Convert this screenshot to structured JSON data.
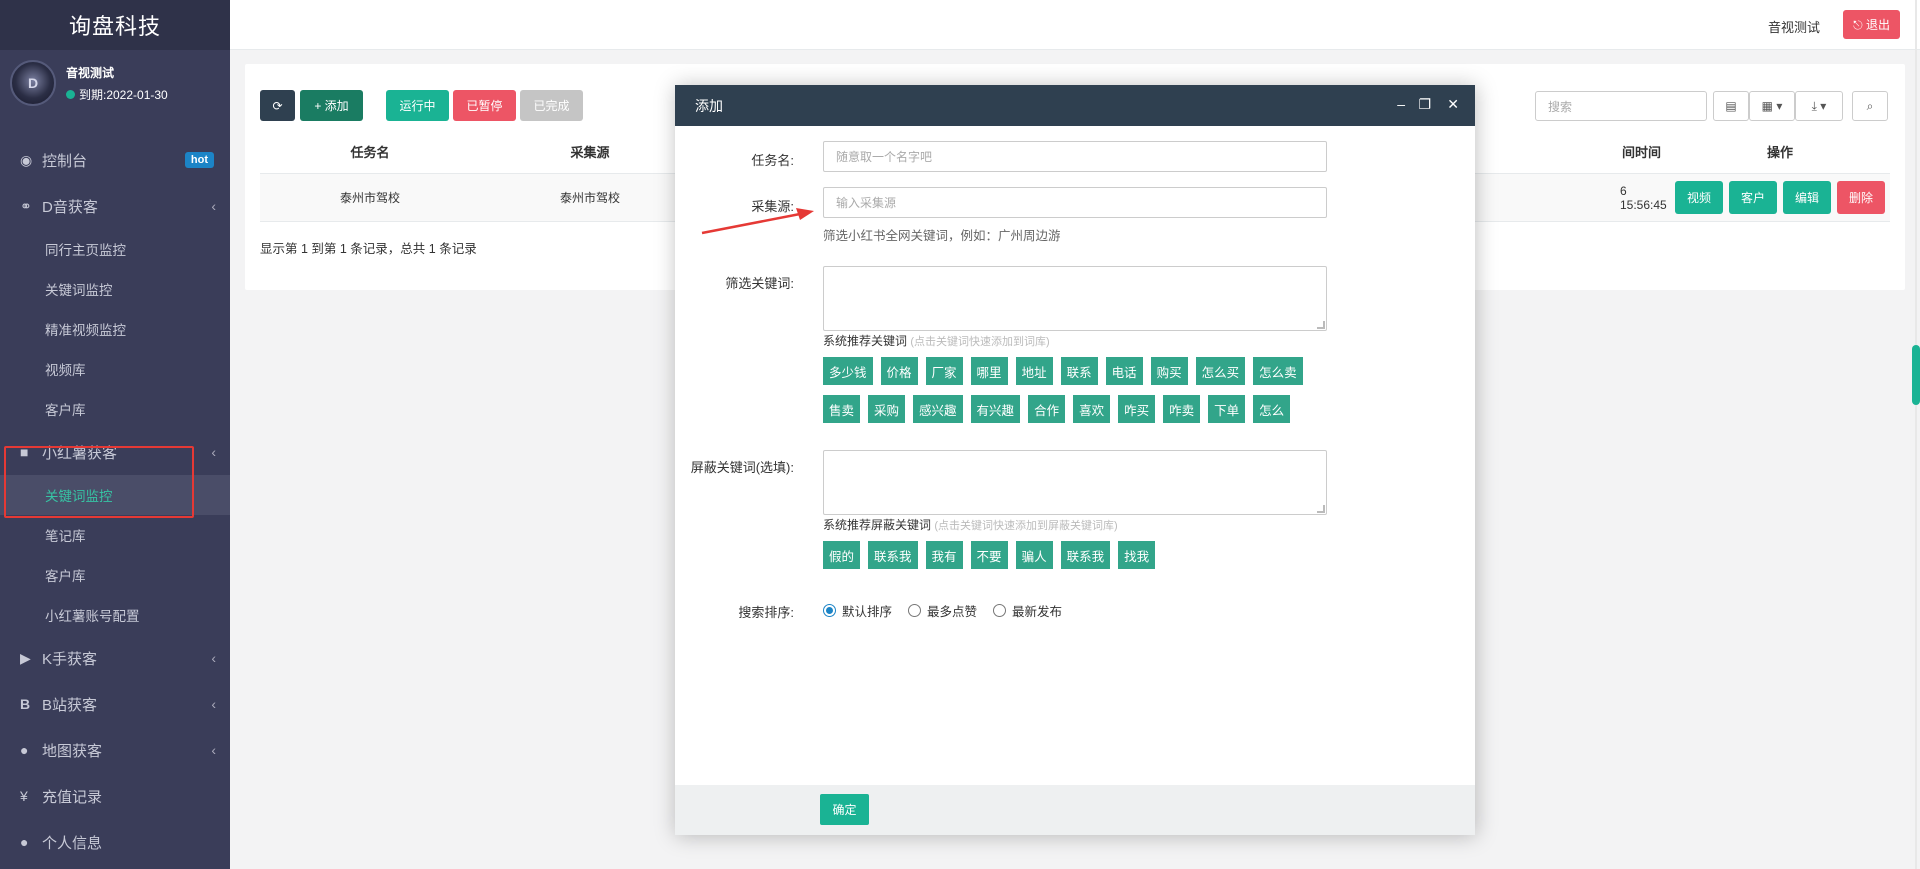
{
  "brand": "询盘科技",
  "profile": {
    "name": "音视测试",
    "expire": "到期:2022-01-30",
    "avatar_text": "D"
  },
  "menu": [
    {
      "icon": "dashboard-icon",
      "glyph": "◉",
      "label": "控制台",
      "badge": "hot"
    },
    {
      "icon": "handshake-icon",
      "glyph": "⚭",
      "label": "D音获客",
      "chevron": true,
      "children": [
        "同行主页监控",
        "关键词监控",
        "精准视频监控",
        "视频库",
        "客户库"
      ]
    },
    {
      "icon": "book-icon",
      "glyph": "■",
      "label": "小红薯获客",
      "chevron": true,
      "children": [
        "关键词监控",
        "笔记库",
        "客户库",
        "小红薯账号配置"
      ],
      "active_child": 0
    },
    {
      "icon": "play-circle-icon",
      "glyph": "▶",
      "label": "K手获客",
      "chevron": true
    },
    {
      "icon": "bilibili-icon",
      "glyph": "B",
      "label": "B站获客",
      "chevron": true
    },
    {
      "icon": "map-marker-icon",
      "glyph": "●",
      "label": "地图获客",
      "chevron": true
    },
    {
      "icon": "yen-icon",
      "glyph": "¥",
      "label": "充值记录"
    },
    {
      "icon": "user-icon",
      "glyph": "●",
      "label": "个人信息"
    }
  ],
  "topbar": {
    "user": "音视测试",
    "logout": "退出"
  },
  "toolbar": {
    "add": "添加",
    "running": "运行中",
    "paused": "已暂停",
    "done": "已完成",
    "search_placeholder": "搜索"
  },
  "table": {
    "headers": [
      "任务名",
      "采集源",
      "间时间",
      "操作"
    ],
    "rows": [
      {
        "task": "泰州市驾校",
        "source": "泰州市驾校",
        "time": "6 15:56:45",
        "actions": [
          "视频",
          "客户",
          "编辑",
          "删除"
        ]
      }
    ],
    "footer": "显示第 1 到第 1 条记录，总共 1 条记录"
  },
  "modal": {
    "title": "添加",
    "task_label": "任务名:",
    "task_placeholder": "随意取一个名字吧",
    "source_label": "采集源:",
    "source_placeholder": "输入采集源",
    "source_help": "筛选小红书全网关键词，例如：广州周边游",
    "filter_label": "筛选关键词:",
    "filter_hint": "系统推荐关键词",
    "filter_hint_muted": "(点击关键词快速添加到词库)",
    "filter_tags_row1": [
      "多少钱",
      "价格",
      "厂家",
      "哪里",
      "地址",
      "联系",
      "电话",
      "购买",
      "怎么买",
      "怎么卖"
    ],
    "filter_tags_row2": [
      "售卖",
      "采购",
      "感兴趣",
      "有兴趣",
      "合作",
      "喜欢",
      "咋买",
      "咋卖",
      "下单",
      "怎么"
    ],
    "block_label": "屏蔽关键词(选填):",
    "block_hint": "系统推荐屏蔽关键词",
    "block_hint_muted": "(点击关键词快速添加到屏蔽关键词库)",
    "block_tags": [
      "假的",
      "联系我",
      "我有",
      "不要",
      "骗人",
      "联系我",
      "找我"
    ],
    "sort_label": "搜索排序:",
    "sort_options": [
      "默认排序",
      "最多点赞",
      "最新发布"
    ],
    "sort_selected": 0,
    "confirm": "确定"
  },
  "colors": {
    "sidebar": "#3a3d59",
    "primary_green": "#1ab394",
    "danger": "#ed5565",
    "modal_header": "#2f4050",
    "tag": "#32a58a"
  }
}
